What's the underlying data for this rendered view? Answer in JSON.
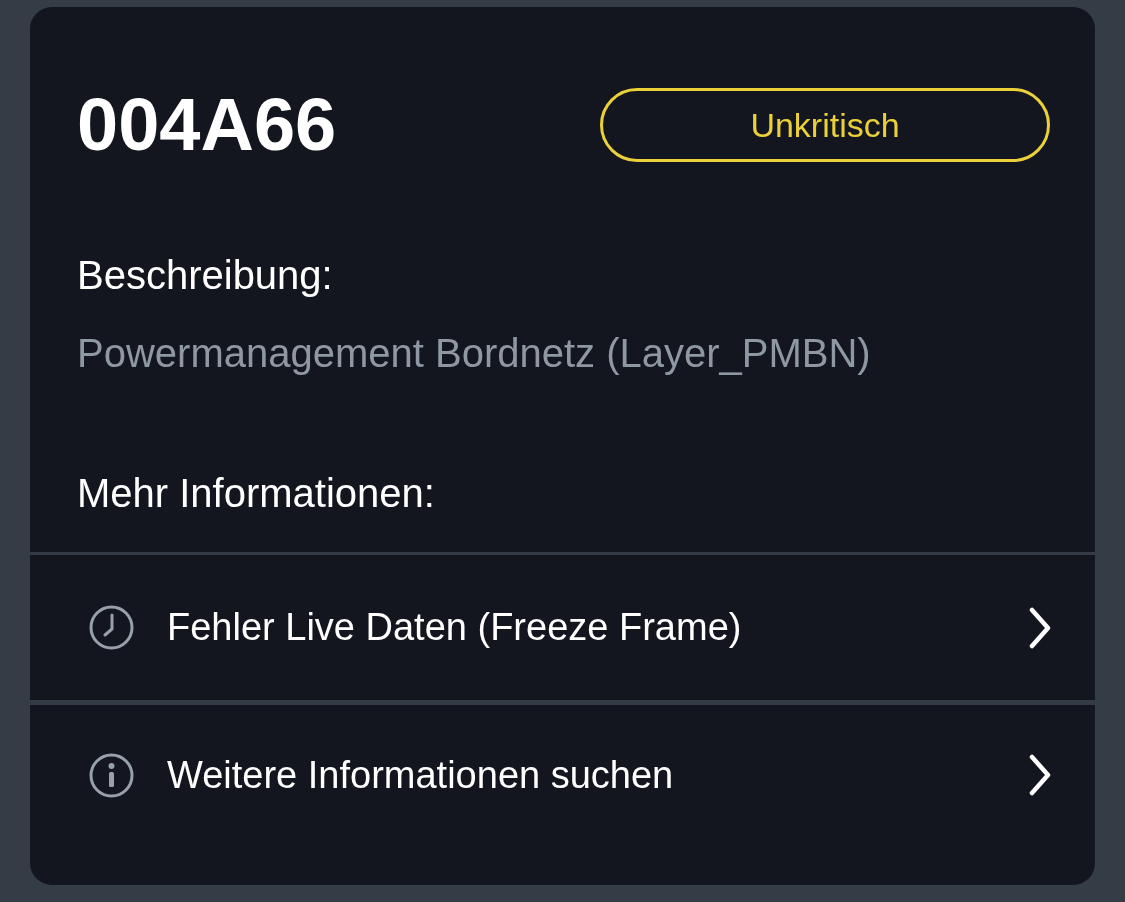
{
  "code": "004A66",
  "severity": {
    "label": "Unkritisch",
    "kind": "uncritical"
  },
  "description": {
    "label": "Beschreibung:",
    "text": "Powermanagement Bordnetz (Layer_PMBN)"
  },
  "more_info": {
    "label": "Mehr Informationen:",
    "items": [
      {
        "kind": "clock",
        "label": "Fehler Live Daten (Freeze Frame)"
      },
      {
        "kind": "info",
        "label": "Weitere Informationen suchen"
      }
    ]
  }
}
